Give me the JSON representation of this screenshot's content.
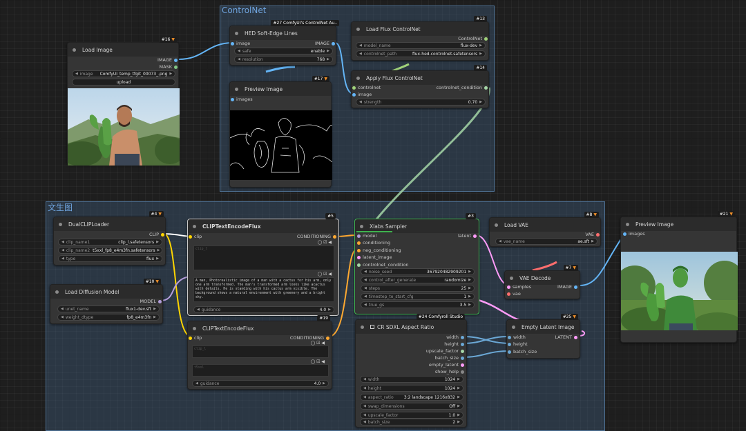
{
  "groups": {
    "controlnet": "ControlNet",
    "txt2img": "文生图"
  },
  "nodes": {
    "load_image": {
      "badge": "#16",
      "title": "Load Image",
      "outputs": [
        "IMAGE",
        "MASK"
      ],
      "image_label": "image",
      "image_value": "ComfyUI_temp_tfgit_00073_.png",
      "upload_label": "upload"
    },
    "hed": {
      "badge": "#27 ComfyUI's ControlNet Au..",
      "title": "HED Soft-Edge Lines",
      "input": "image",
      "output": "IMAGE",
      "widgets": [
        {
          "label": "safe",
          "value": "enable"
        },
        {
          "label": "resolution",
          "value": "768"
        }
      ]
    },
    "preview_image_cn": {
      "badge": "#17",
      "title": "Preview Image",
      "input": "images"
    },
    "load_flux_controlnet": {
      "badge": "#13",
      "title": "Load Flux ControlNet",
      "output": "ControlNet",
      "widgets": [
        {
          "label": "model_name",
          "value": "flux-dev"
        },
        {
          "label": "controlnet_path",
          "value": "flux-hed-controlnet.safetensors"
        }
      ]
    },
    "apply_flux_controlnet": {
      "badge": "#14",
      "title": "Apply Flux ControlNet",
      "inputs": [
        "controlnet",
        "image"
      ],
      "output": "controlnet_condition",
      "widgets": [
        {
          "label": "strength",
          "value": "0.70"
        }
      ]
    },
    "dual_clip": {
      "badge": "#4",
      "title": "DualCLIPLoader",
      "output": "CLIP",
      "widgets": [
        {
          "label": "clip_name1",
          "value": "clip_l.safetensors"
        },
        {
          "label": "clip_name2",
          "value": "t5xxl_fp8_e4m3fn.safetensors"
        },
        {
          "label": "type",
          "value": "flux"
        }
      ]
    },
    "load_diffusion": {
      "badge": "#10",
      "title": "Load Diffusion Model",
      "output": "MODEL",
      "widgets": [
        {
          "label": "unet_name",
          "value": "flux1-dev.sft"
        },
        {
          "label": "weight_dtype",
          "value": "fp8_e4m3fn"
        }
      ]
    },
    "clip_encode_pos": {
      "badge": "#5",
      "title": "CLIPTextEncodeFlux",
      "input": "clip",
      "output": "CONDITIONING",
      "clip_l_placeholder": "clip_l",
      "t5xxl_text": "A man, Photorealistic image of a man with a cactus for his arm, only one arm transformed. The man's transformed arm looks like acactus with details. He is standing with his cactus arm visible. The background shows a natural environment with greenery and a bright sky.",
      "guidance_label": "guidance",
      "guidance_value": "4.0",
      "toggle": "◯ ☑ ◀"
    },
    "clip_encode_neg": {
      "badge": "#19",
      "title": "CLIPTextEncodeFlux",
      "input": "clip",
      "output": "CONDITIONING",
      "clip_l_placeholder": "clip_l",
      "t5xxl_placeholder": "t5xxl",
      "guidance_label": "guidance",
      "guidance_value": "4.0",
      "toggle": "◯ ☑ ◀"
    },
    "xlabs_sampler": {
      "badge": "#3",
      "title": "Xlabs Sampler",
      "inputs": [
        "model",
        "conditioning",
        "neg_conditioning",
        "latent_image",
        "controlnet_condition"
      ],
      "output": "latent",
      "widgets": [
        {
          "label": "noise_seed",
          "value": "367920482909201"
        },
        {
          "label": "control_after_generate",
          "value": "randomize"
        },
        {
          "label": "steps",
          "value": "25"
        },
        {
          "label": "timestep_to_start_cfg",
          "value": "1"
        },
        {
          "label": "true_gs",
          "value": "3.5"
        }
      ]
    },
    "load_vae": {
      "badge": "#8",
      "title": "Load VAE",
      "output": "VAE",
      "widgets": [
        {
          "label": "vae_name",
          "value": "ae.sft"
        }
      ]
    },
    "vae_decode": {
      "badge": "#7",
      "title": "VAE Decode",
      "inputs": [
        "samples",
        "vae"
      ],
      "output": "IMAGE"
    },
    "preview_image_out": {
      "badge": "#21",
      "title": "Preview Image",
      "input": "images"
    },
    "aspect_ratio": {
      "badge": "#24 Comfyroll Studio",
      "title": "CR SDXL Aspect Ratio",
      "outputs": [
        "width",
        "height",
        "upscale_factor",
        "batch_size",
        "empty_latent",
        "show_help"
      ],
      "widgets": [
        {
          "label": "width",
          "value": "1024"
        },
        {
          "label": "height",
          "value": "1024"
        },
        {
          "label": "aspect_ratio",
          "value": "3:2 landscape 1216x832"
        },
        {
          "label": "swap_dimensions",
          "value": "Off"
        },
        {
          "label": "upscale_factor",
          "value": "1.0"
        },
        {
          "label": "batch_size",
          "value": "2"
        }
      ]
    },
    "empty_latent": {
      "badge": "#25",
      "title": "Empty Latent Image",
      "inputs": [
        "width",
        "height",
        "batch_size"
      ],
      "output": "LATENT"
    }
  },
  "colors": {
    "image": "#64b5f6",
    "mask": "#81c784",
    "clip": "#ffd500",
    "conditioning": "#ffa931",
    "model": "#b39ddb",
    "vae": "#ff6e6e",
    "latent": "#ff9cf9",
    "controlnet": "#a0d27a",
    "int": "#6ba8d6",
    "float": "#a5d6a7"
  },
  "icons": {
    "badge_icon": "fox-icon",
    "widget_left": "triangle-left-icon",
    "widget_right": "triangle-right-icon"
  }
}
